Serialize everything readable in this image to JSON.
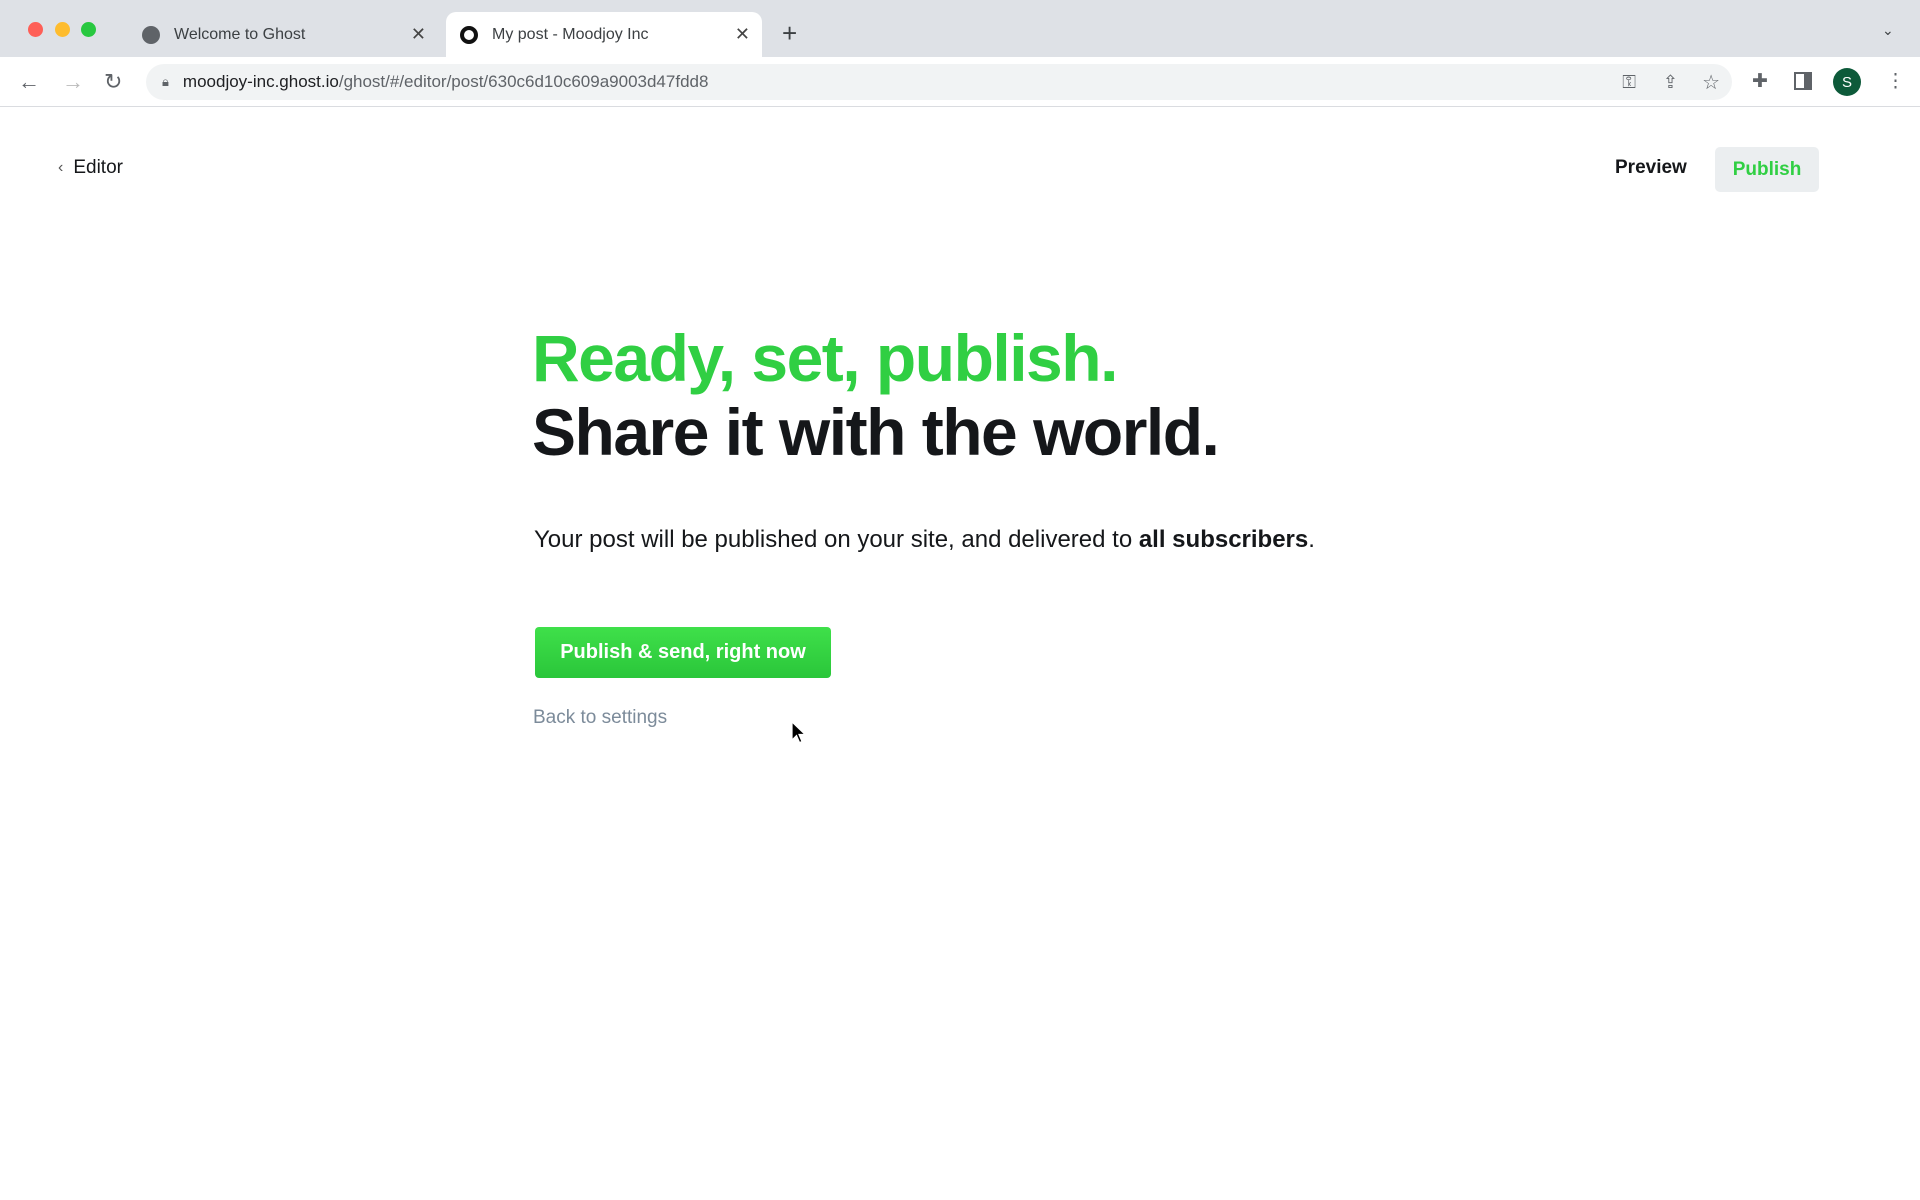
{
  "browser": {
    "tabs": [
      {
        "title": "Welcome to Ghost",
        "icon": "globe-icon"
      },
      {
        "title": "My post - Moodjoy Inc",
        "icon": "ghost-icon",
        "active": true
      }
    ],
    "url_host": "moodjoy-inc.ghost.io",
    "url_path": "/ghost/#/editor/post/630c6d10c609a9003d47fdd8",
    "profile_initial": "S"
  },
  "header": {
    "back_label": "Editor",
    "preview_label": "Preview",
    "publish_label": "Publish"
  },
  "main": {
    "headline_1": "Ready, set, publish.",
    "headline_2": "Share it with the world.",
    "desc_prefix": "Your post will be published on your site, and delivered to ",
    "desc_bold": "all subscribers",
    "desc_suffix": ".",
    "cta_label": "Publish & send, right now",
    "back_settings": "Back to settings"
  },
  "colors": {
    "accent": "#30cf43",
    "text": "#15171a"
  }
}
